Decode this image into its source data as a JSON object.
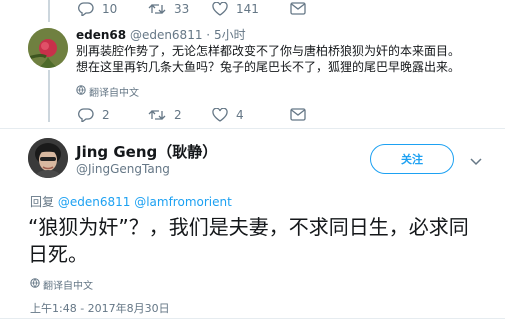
{
  "prev_tweet_actions": {
    "replies": "10",
    "retweets": "33",
    "likes": "141"
  },
  "reply_tweet": {
    "name": "eden68",
    "handle": "@eden6811",
    "separator": "·",
    "time": "5小时",
    "text_line1": "别再装腔作势了，无论怎样都改变不了你与唐柏桥狼狈为奸的本来面目。",
    "text_line2": "想在这里再钓几条大鱼吗？兔子的尾巴长不了，狐狸的尾巴早晚露出来。",
    "translate_label": "翻译自中文",
    "actions": {
      "replies": "2",
      "retweets": "2",
      "likes": "4"
    }
  },
  "main_tweet": {
    "name": "Jing Geng（耿静）",
    "handle": "@JingGengTang",
    "follow_label": "关注",
    "reply_prefix": "回复",
    "mention1": "@eden6811",
    "mention2": "@lamfromorient",
    "text": "“狼狈为奸”？，我们是夫妻，不求同日生，必求同日死。",
    "translate_label": "翻译自中文",
    "timestamp": "上午1:48 - 2017年8月30日"
  },
  "colors": {
    "accent": "#1da1f2",
    "secondary_text": "#657786",
    "primary_text": "#14171a"
  }
}
